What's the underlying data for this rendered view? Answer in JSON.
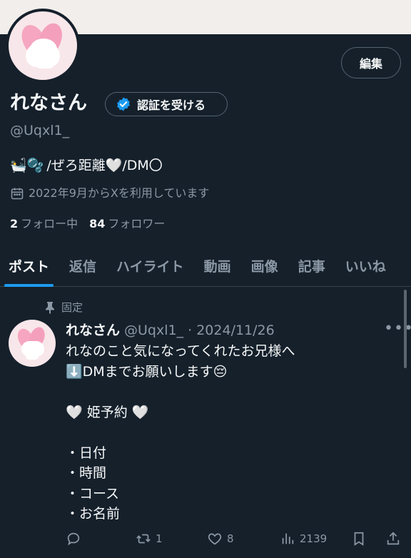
{
  "profile": {
    "edit_label": "編集",
    "name": "れなさん",
    "verify_label": "認証を受ける",
    "handle": "@Uqxl1_",
    "bio_emojis": "🛀🫧",
    "bio_text": "/ぜろ距離🤍/DM〇",
    "joined": "2022年9月からXを利用しています",
    "following_count": "2",
    "following_label": "フォロー中",
    "followers_count": "84",
    "followers_label": "フォロワー"
  },
  "tabs": [
    "ポスト",
    "返信",
    "ハイライト",
    "動画",
    "画像",
    "記事",
    "いいね"
  ],
  "post": {
    "pinned_label": "固定",
    "author_name": "れなさん",
    "author_meta": "@Uqxl1_ · 2024/11/26",
    "lines": [
      "れなのこと気になってくれたお兄様へ",
      "⬇️DMまでお願いします😔",
      "",
      "🤍 姫予約 🤍",
      "",
      "・日付",
      "・時間",
      "・コース",
      "・お名前"
    ],
    "retweets": "1",
    "likes": "8",
    "views": "2139"
  },
  "colors": {
    "background": "#15202b",
    "accent": "#1d9bf0",
    "secondary_text": "#8b98a5"
  }
}
